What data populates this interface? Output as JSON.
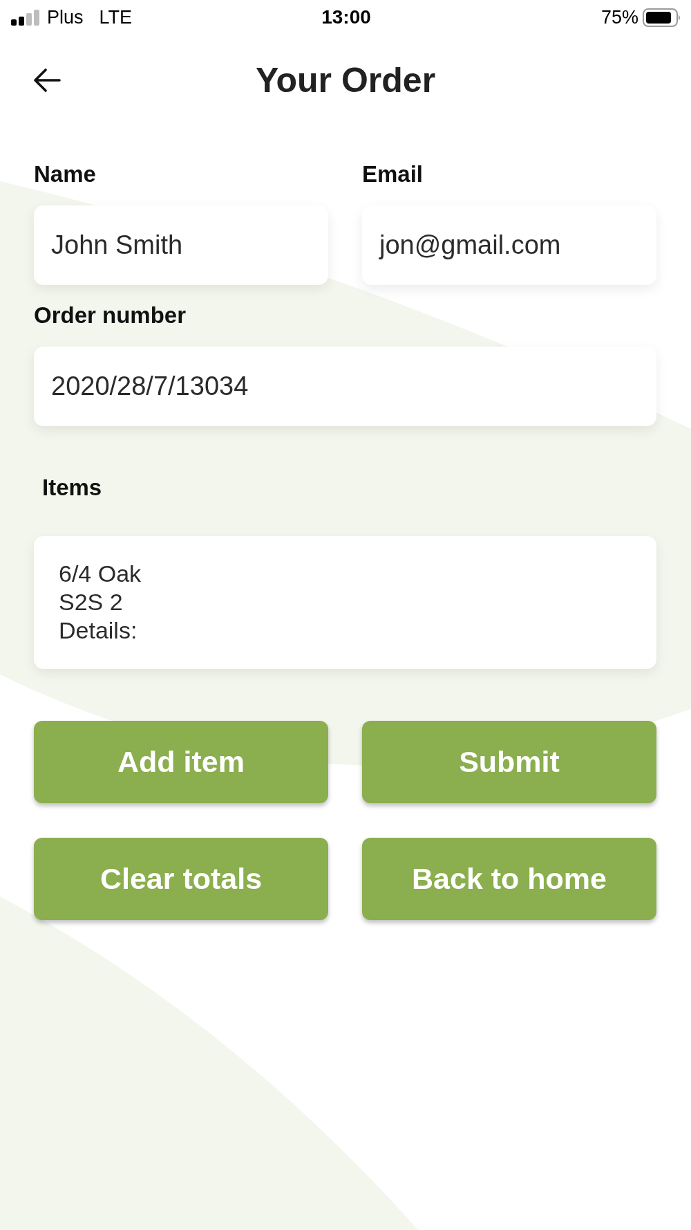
{
  "status_bar": {
    "carrier": "Plus",
    "network": "LTE",
    "time": "13:00",
    "battery": "75%"
  },
  "header": {
    "title": "Your Order"
  },
  "form": {
    "rows": [
      [
        {
          "label": "Name",
          "value": "John Smith"
        },
        {
          "label": "Email",
          "value": "jon@gmail.com"
        }
      ],
      [
        {
          "label": "Order number",
          "value": "2020/28/7/13034"
        }
      ]
    ],
    "items": {
      "label": "Items",
      "value": "6/4 Oak\nS2S 2\nDetails:"
    }
  },
  "buttons": [
    "Add item",
    "Submit",
    "Clear totals",
    "Back to home"
  ]
}
